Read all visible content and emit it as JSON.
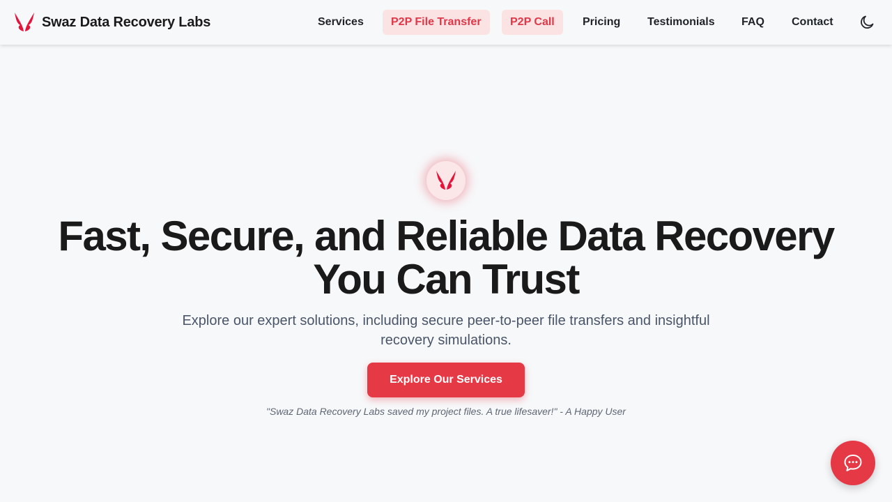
{
  "brand": {
    "name": "Swaz Data Recovery Labs",
    "logo_icon": "butterfly-icon",
    "accent_color": "#e63946"
  },
  "nav": {
    "items": [
      {
        "label": "Services",
        "highlighted": false
      },
      {
        "label": "P2P File Transfer",
        "highlighted": true
      },
      {
        "label": "P2P Call",
        "highlighted": true
      },
      {
        "label": "Pricing",
        "highlighted": false
      },
      {
        "label": "Testimonials",
        "highlighted": false
      },
      {
        "label": "FAQ",
        "highlighted": false
      },
      {
        "label": "Contact",
        "highlighted": false
      }
    ],
    "theme_toggle_icon": "moon-icon"
  },
  "hero": {
    "logo_icon": "butterfly-icon",
    "title_line1": "Fast, Secure, and Reliable Data Recovery",
    "title_line2": "You Can Trust",
    "subtitle": "Explore our expert solutions, including secure peer-to-peer file transfers and insightful recovery simulations.",
    "cta_label": "Explore Our Services",
    "testimonial": "\"Swaz Data Recovery Labs saved my project files. A true lifesaver!\" - A Happy User"
  },
  "chat": {
    "icon": "chat-bubble-icon"
  }
}
